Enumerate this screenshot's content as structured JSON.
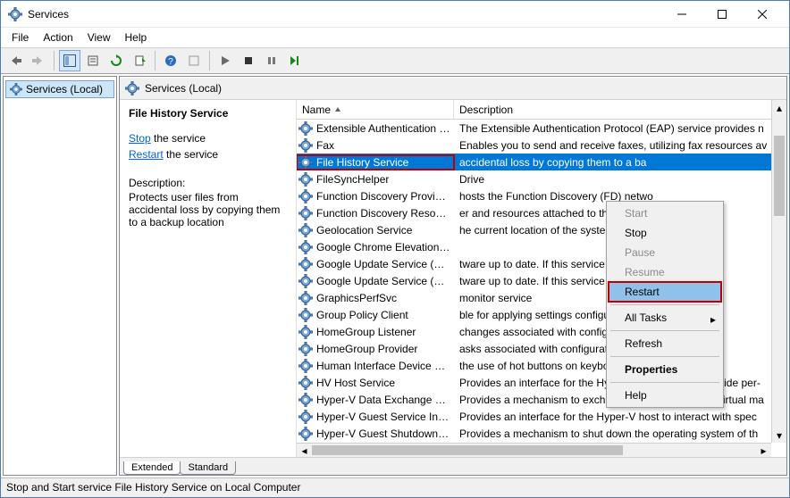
{
  "window": {
    "title": "Services"
  },
  "menubar": [
    "File",
    "Action",
    "View",
    "Help"
  ],
  "left_tree": {
    "root": "Services (Local)"
  },
  "right_header": "Services (Local)",
  "detail": {
    "service_title": "File History Service",
    "stop_label": "Stop",
    "stop_suffix": " the service",
    "restart_label": "Restart",
    "restart_suffix": " the service",
    "description_label": "Description:",
    "description_text": "Protects user files from accidental loss by copying them to a backup location"
  },
  "columns": {
    "name": "Name",
    "description": "Description"
  },
  "services": [
    {
      "name": "Extensible Authentication P…",
      "desc": "The Extensible Authentication Protocol (EAP) service provides n"
    },
    {
      "name": "Fax",
      "desc": "Enables you to send and receive faxes, utilizing fax resources av"
    },
    {
      "name": "File History Service",
      "desc": "accidental loss by copying them to a ba",
      "selected": true
    },
    {
      "name": "FileSyncHelper",
      "desc": "Drive"
    },
    {
      "name": "Function Discovery Provid…",
      "desc": "hosts the Function Discovery (FD) netwo"
    },
    {
      "name": "Function Discovery Resou…",
      "desc": "er and resources attached to this comput"
    },
    {
      "name": "Geolocation Service",
      "desc": "he current location of the system and ma"
    },
    {
      "name": "Google Chrome Elevation …",
      "desc": ""
    },
    {
      "name": "Google Update Service (g…",
      "desc": "tware up to date. If this service is disable"
    },
    {
      "name": "Google Update Service (g…",
      "desc": "tware up to date. If this service is disable"
    },
    {
      "name": "GraphicsPerfSvc",
      "desc": "monitor service"
    },
    {
      "name": "Group Policy Client",
      "desc": "ble for applying settings configured by a"
    },
    {
      "name": "HomeGroup Listener",
      "desc": "changes associated with configuration a"
    },
    {
      "name": "HomeGroup Provider",
      "desc": "asks associated with configuration and n"
    },
    {
      "name": "Human Interface Device Se…",
      "desc": "the use of hot buttons on keyboards, re"
    },
    {
      "name": "HV Host Service",
      "desc": "Provides an interface for the Hyper-V hypervisor to provide per-"
    },
    {
      "name": "Hyper-V Data Exchange Ser…",
      "desc": "Provides a mechanism to exchange data between the virtual ma"
    },
    {
      "name": "Hyper-V Guest Service Inter…",
      "desc": "Provides an interface for the Hyper-V host to interact with spec"
    },
    {
      "name": "Hyper-V Guest Shutdown S…",
      "desc": "Provides a mechanism to shut down the operating system of th"
    }
  ],
  "context_menu": {
    "start": "Start",
    "stop": "Stop",
    "pause": "Pause",
    "resume": "Resume",
    "restart": "Restart",
    "all_tasks": "All Tasks",
    "refresh": "Refresh",
    "properties": "Properties",
    "help": "Help"
  },
  "tabs": {
    "extended": "Extended",
    "standard": "Standard"
  },
  "statusbar": "Stop and Start service File History Service on Local Computer"
}
